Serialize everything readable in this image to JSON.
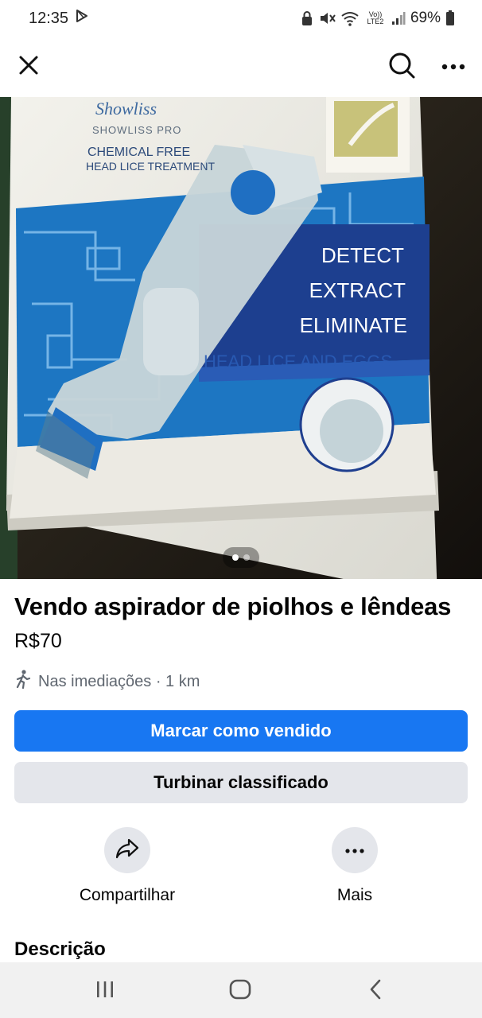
{
  "status_bar": {
    "time": "12:35",
    "network_label": "Vo)) LTE2",
    "battery": "69%"
  },
  "product_image": {
    "brand": "Showliss",
    "brand_sub": "SHOWLISS PRO",
    "tagline_line1": "CHEMICAL FREE",
    "tagline_line2": "HEAD LICE TREATMENT",
    "feature_1": "DETECT",
    "feature_2": "EXTRACT",
    "feature_3": "ELIMINATE",
    "feature_sub": "HEAD LICE AND EGGS",
    "current_image": 1,
    "image_count": 2
  },
  "listing": {
    "title": "Vendo aspirador de piolhos e lêndeas",
    "price": "R$70",
    "location": "Nas imediações · 1 km"
  },
  "buttons": {
    "mark_sold": "Marcar como vendido",
    "boost": "Turbinar classificado"
  },
  "actions": {
    "share": "Compartilhar",
    "more": "Mais"
  },
  "description": {
    "heading": "Descrição"
  },
  "colors": {
    "primary": "#1877f2",
    "secondary_bg": "#e4e6eb",
    "text": "#050505",
    "muted": "#606770"
  },
  "icons": {
    "close": "close-icon",
    "search": "search-icon",
    "more": "more-dots-icon",
    "share": "share-arrow-icon",
    "walking": "walking-person-icon"
  }
}
